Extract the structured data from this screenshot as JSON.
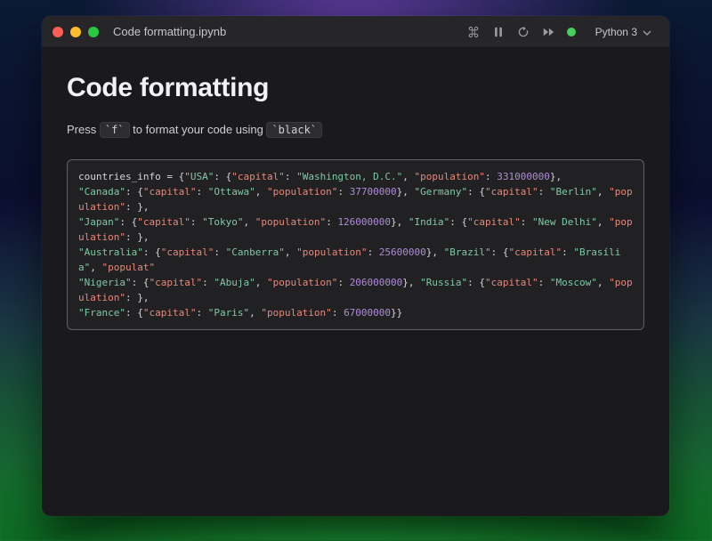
{
  "window": {
    "title": "Code formatting.ipynb",
    "kernel": "Python 3"
  },
  "notebook": {
    "heading": "Code formatting",
    "instruction_parts": {
      "prefix": "Press ",
      "key": "`f`",
      "middle": " to format your code using ",
      "tool": "`black`"
    }
  },
  "code": {
    "var_name": "countries_info",
    "entries": [
      {
        "country": "USA",
        "capital": "Washington, D.C.",
        "population": 331000000
      },
      {
        "country": "Canada",
        "capital": "Ottawa",
        "population": 37700000
      },
      {
        "country": "Germany",
        "capital": "Berlin",
        "population": null
      },
      {
        "country": "Japan",
        "capital": "Tokyo",
        "population": 126000000
      },
      {
        "country": "India",
        "capital": "New Delhi",
        "population": null
      },
      {
        "country": "Australia",
        "capital": "Canberra",
        "population": 25600000
      },
      {
        "country": "Brazil",
        "capital": "Brasília",
        "population": null,
        "population_key_truncated": "populat"
      },
      {
        "country": "Nigeria",
        "capital": "Abuja",
        "population": 206000000
      },
      {
        "country": "Russia",
        "capital": "Moscow",
        "population": null
      },
      {
        "country": "France",
        "capital": "Paris",
        "population": 67000000
      }
    ],
    "line_breaks_after": [
      "USA",
      "Germany",
      "India",
      "Brazil",
      "Russia"
    ]
  },
  "icons": {
    "close": "close-icon",
    "minimize": "minimize-icon",
    "zoom": "zoom-icon",
    "command": "command-icon",
    "pause": "pause-icon",
    "reload": "reload-icon",
    "forward": "fast-forward-icon",
    "status": "kernel-status-indicator",
    "chevron": "chevron-down-icon"
  }
}
